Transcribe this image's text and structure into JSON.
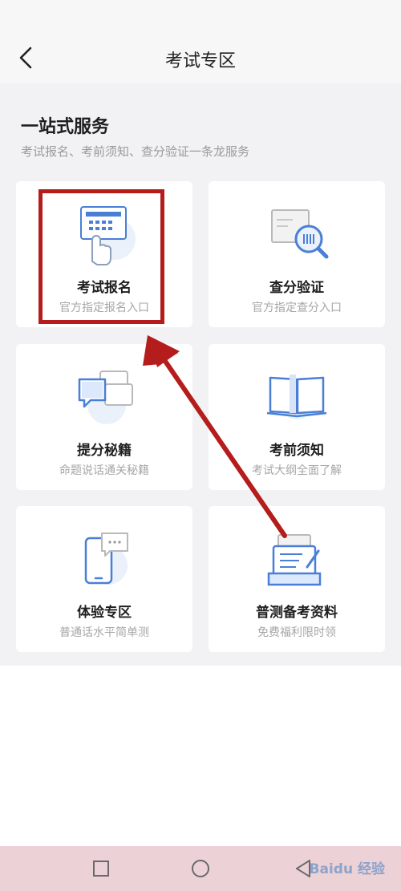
{
  "header": {
    "title": "考试专区"
  },
  "section": {
    "title": "一站式服务",
    "subtitle": "考试报名、考前须知、查分验证一条龙服务"
  },
  "cards": [
    {
      "title": "考试报名",
      "subtitle": "官方指定报名入口",
      "icon": "registration-icon"
    },
    {
      "title": "查分验证",
      "subtitle": "官方指定查分入口",
      "icon": "score-check-icon"
    },
    {
      "title": "提分秘籍",
      "subtitle": "命题说话通关秘籍",
      "icon": "chat-bubbles-icon"
    },
    {
      "title": "考前须知",
      "subtitle": "考试大纲全面了解",
      "icon": "book-icon"
    },
    {
      "title": "体验专区",
      "subtitle": "普通话水平简单测",
      "icon": "phone-chat-icon"
    },
    {
      "title": "普测备考资料",
      "subtitle": "免费福利限时领",
      "icon": "materials-icon"
    }
  ],
  "watermark": {
    "text": "Baidu 经验"
  },
  "colors": {
    "accent_blue": "#4a7fd6",
    "highlight_red": "#b51d1d"
  }
}
